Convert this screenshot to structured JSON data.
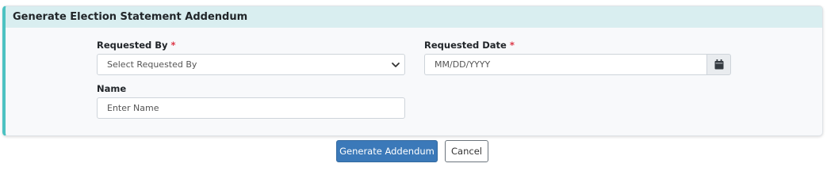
{
  "card": {
    "title": "Generate Election Statement Addendum"
  },
  "form": {
    "requested_by": {
      "label": "Requested By",
      "required_mark": "*",
      "value": "Select Requested By",
      "icon": "chevron-down-icon"
    },
    "requested_date": {
      "label": "Requested Date",
      "required_mark": "*",
      "placeholder": "MM/DD/YYYY",
      "icon": "calendar-icon"
    },
    "name": {
      "label": "Name",
      "placeholder": "Enter Name"
    }
  },
  "actions": {
    "generate_label": "Generate Addendum",
    "cancel_label": "Cancel"
  },
  "colors": {
    "accent": "#4dc2c2",
    "header_bg": "#d9eef0",
    "primary": "#3b79b9",
    "required": "#dc3545"
  }
}
